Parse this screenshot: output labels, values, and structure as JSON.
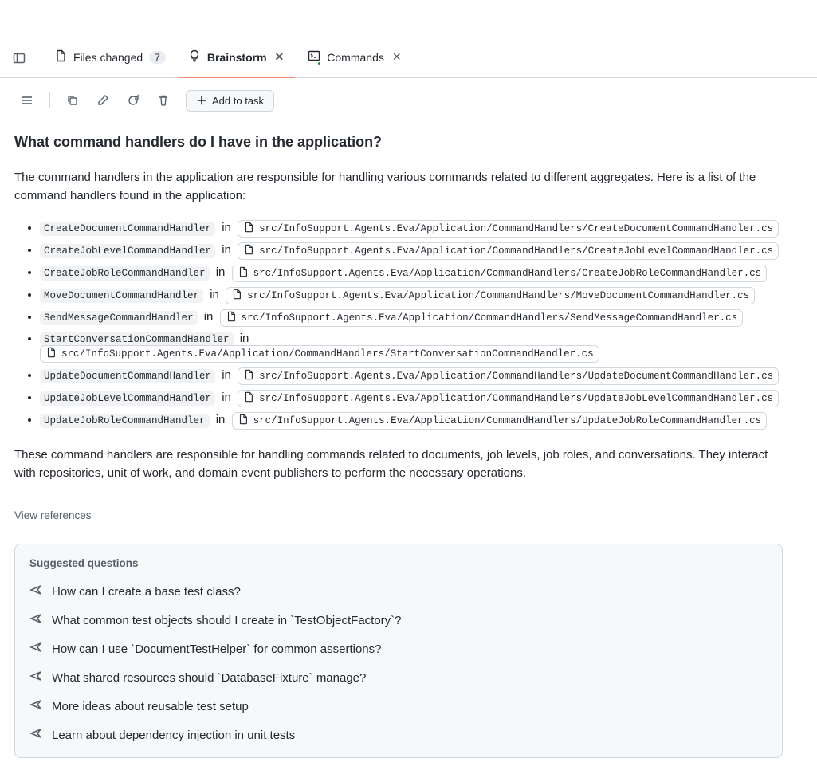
{
  "tabs": {
    "panel_left_icon": "panel-left",
    "files_changed": {
      "label": "Files changed",
      "count": "7"
    },
    "brainstorm": {
      "label": "Brainstorm"
    },
    "commands": {
      "label": "Commands"
    }
  },
  "toolbar": {
    "add_to_task": "Add to task"
  },
  "question": "What command handlers do I have in the application?",
  "intro_para": "The command handlers in the application are responsible for handling various commands related to different aggregates. Here is a list of the command handlers found in the application:",
  "in_word": "in",
  "handlers": [
    {
      "name": "CreateDocumentCommandHandler",
      "path": "src/InfoSupport.Agents.Eva/Application/CommandHandlers/CreateDocumentCommandHandler.cs"
    },
    {
      "name": "CreateJobLevelCommandHandler",
      "path": "src/InfoSupport.Agents.Eva/Application/CommandHandlers/CreateJobLevelCommandHandler.cs"
    },
    {
      "name": "CreateJobRoleCommandHandler",
      "path": "src/InfoSupport.Agents.Eva/Application/CommandHandlers/CreateJobRoleCommandHandler.cs"
    },
    {
      "name": "MoveDocumentCommandHandler",
      "path": "src/InfoSupport.Agents.Eva/Application/CommandHandlers/MoveDocumentCommandHandler.cs"
    },
    {
      "name": "SendMessageCommandHandler",
      "path": "src/InfoSupport.Agents.Eva/Application/CommandHandlers/SendMessageCommandHandler.cs"
    },
    {
      "name": "StartConversationCommandHandler",
      "path": "src/InfoSupport.Agents.Eva/Application/CommandHandlers/StartConversationCommandHandler.cs"
    },
    {
      "name": "UpdateDocumentCommandHandler",
      "path": "src/InfoSupport.Agents.Eva/Application/CommandHandlers/UpdateDocumentCommandHandler.cs"
    },
    {
      "name": "UpdateJobLevelCommandHandler",
      "path": "src/InfoSupport.Agents.Eva/Application/CommandHandlers/UpdateJobLevelCommandHandler.cs"
    },
    {
      "name": "UpdateJobRoleCommandHandler",
      "path": "src/InfoSupport.Agents.Eva/Application/CommandHandlers/UpdateJobRoleCommandHandler.cs"
    }
  ],
  "outro_para": "These command handlers are responsible for handling commands related to documents, job levels, job roles, and conversations. They interact with repositories, unit of work, and domain event publishers to perform the necessary operations.",
  "view_references": "View references",
  "suggestions": {
    "title": "Suggested questions",
    "items": [
      "How can I create a base test class?",
      "What common test objects should I create in `TestObjectFactory`?",
      "How can I use `DocumentTestHelper` for common assertions?",
      "What shared resources should `DatabaseFixture` manage?",
      "More ideas about reusable test setup",
      "Learn about dependency injection in unit tests"
    ]
  }
}
